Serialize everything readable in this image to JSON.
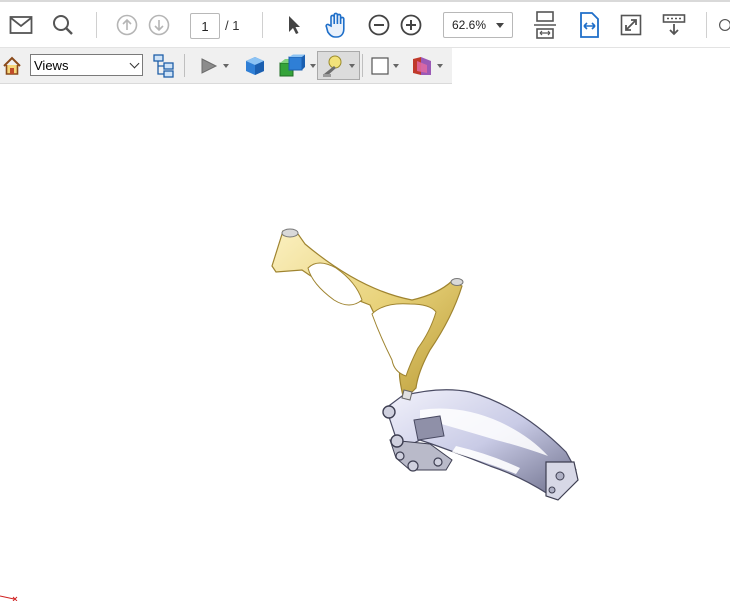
{
  "toolbar": {
    "page_current": "1",
    "page_separator": "/ 1",
    "zoom": "62.6%",
    "icons": [
      "mail-icon",
      "search-icon",
      "page-up-icon",
      "page-down-icon",
      "select-tool-icon",
      "hand-tool-icon",
      "zoom-out-icon",
      "zoom-in-icon",
      "fit-page-icon",
      "fit-width-icon",
      "fullscreen-icon",
      "read-mode-icon"
    ]
  },
  "toolbar3d": {
    "views_label": "Views",
    "icons": [
      "home-view-icon",
      "model-tree-icon",
      "play-animation-icon",
      "model-render-icon",
      "lighting-cube-icon",
      "lighting-icon",
      "background-color-icon",
      "cross-section-icon"
    ]
  },
  "viewer": {
    "model": "bicycle-frame-3d-model",
    "colors": {
      "main_frame": "#e8d27a",
      "swingarm": "#c9cbe6"
    }
  }
}
